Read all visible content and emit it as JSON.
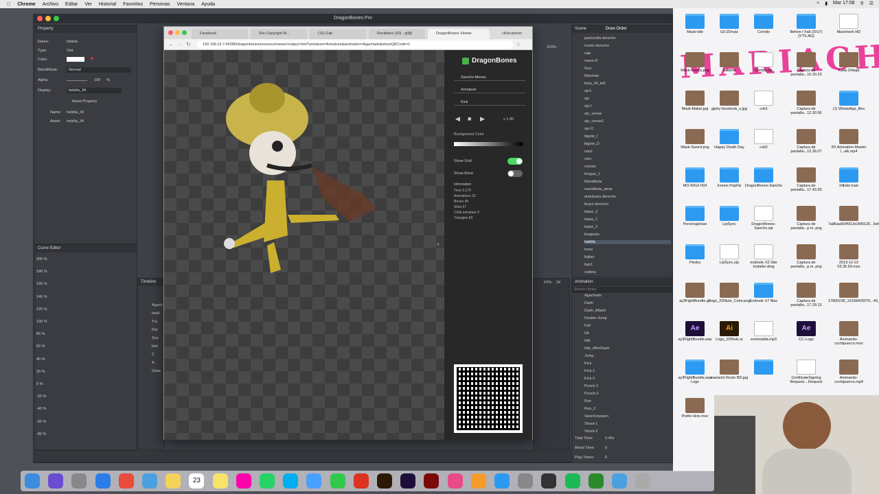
{
  "menubar": {
    "items": [
      "Chrome",
      "Archivo",
      "Editar",
      "Ver",
      "Historial",
      "Favoritos",
      "Personas",
      "Ventana",
      "Ayuda"
    ],
    "clock": "Mar 17:08"
  },
  "app": {
    "title": "DragonBones Pro",
    "property_panel": {
      "tab": "Property",
      "rows": [
        {
          "label": "Name:",
          "value": "hebilla"
        },
        {
          "label": "Type:",
          "value": "Slot"
        },
        {
          "label": "Color:",
          "value": ""
        },
        {
          "label": "BlendMode:",
          "value": "Normal"
        },
        {
          "label": "Alpha:",
          "value": "100"
        },
        {
          "label": "Display:",
          "value": "hebilla_34"
        }
      ],
      "asset_header": "Asset Property",
      "asset_rows": [
        {
          "label": "Name:",
          "value": "hebilla_34"
        },
        {
          "label": "Asset:",
          "value": "hebilla_34"
        }
      ],
      "alpha_unit": "%"
    },
    "curve_editor": {
      "tab": "Curve Editor",
      "ticks": [
        "200 %",
        "180 %",
        "160 %",
        "140 %",
        "120 %",
        "100 %",
        "80 %",
        "60 %",
        "40 %",
        "20 %",
        "0 %",
        "-20 %",
        "-40 %",
        "-60 %",
        "-80 %"
      ]
    },
    "timeline_tab": "Timeline",
    "timeline_items": [
      "Agach",
      "hebil",
      "Tra",
      "Rot",
      "Sca",
      "heb",
      "C",
      "A",
      "Draw"
    ],
    "fps": {
      "label": "FPS:",
      "value": "24"
    },
    "scene_tab": "Scene",
    "draw_order_tab": "Draw Order",
    "zoom": "215%",
    "draw_order_items": [
      "pantorrilla derecho",
      "muslo derecho",
      "raja",
      "mano-D",
      "Gun",
      "Machete",
      "bota_34_left",
      "ojo1",
      "ojo",
      "ojo-I",
      "ojo_venas",
      "ojo_venas1",
      "ojo-D",
      "bigote_I",
      "bigote_D",
      "nariz",
      "cien",
      "craneo",
      "lengua_1",
      "Mandibula",
      "mandibula_atras",
      "antebrazo derecho",
      "brazo derecho",
      "balas_3",
      "balas_1",
      "balas_2",
      "bragueta",
      "hebilla",
      "torso",
      "fajitas",
      "fajo1",
      "cadera"
    ],
    "animation_tab": "Animation",
    "search_placeholder": "Search Library",
    "animation_items": [
      "Agachado",
      "Dash",
      "Dash_Attack",
      "Double-Jump",
      "Fall",
      "Hit",
      "Idle",
      "Idle_AfterDash",
      "Jump",
      "Kick",
      "Kick-1",
      "Kick-2",
      "Punch-1",
      "Punch-2",
      "Run",
      "Run_2",
      "Sanchoryuken",
      "Shoot-1",
      "Shoot-2"
    ],
    "total_time": {
      "label": "Total Time:",
      "value": "0.46s"
    },
    "blend_time": {
      "label": "Blend Time:",
      "value": "0"
    },
    "play_times": {
      "label": "Play Times:",
      "value": "0"
    }
  },
  "browser": {
    "tabs": [
      "Facebook",
      "(No Copyright M...",
      "(16) Giip",
      "Recibidos (30) - gil@",
      "DragonBones Viewer",
      "clickcartoon"
    ],
    "url": "192.168.15.7:49286/dragonbones/resource/viewer/output.html?armature=Armature&animation=Agachado&showQRCode=1",
    "side": {
      "brand": "DragonBones",
      "dragonbones": "Sancho-Moves",
      "armature": "Armature",
      "animation": "Kick",
      "speed": "x 1.00",
      "bg_color_label": "Background Color",
      "show_grid": "Show Grid",
      "show_bone": "Show Bone",
      "info_title": "Information",
      "info": [
        "Time 0.179",
        "Animations 32",
        "Bones 45",
        "Slots 57",
        "Child armature 0",
        "Triangles 83"
      ]
    }
  },
  "desktop": {
    "scribble": "MARIACHI",
    "icons": [
      {
        "label": "Mask-Idle",
        "type": "folder"
      },
      {
        "label": "Gil-2Dnutz",
        "type": "folder"
      },
      {
        "label": "Corrido",
        "type": "folder"
      },
      {
        "label": "Before I Fall (2017) [YTS.AG]",
        "type": "folder"
      },
      {
        "label": "Macintosh HD",
        "type": "file"
      },
      {
        "label": "Mask-invoca.png",
        "type": "img"
      },
      {
        "label": "Gilberto",
        "type": "img"
      },
      {
        "label": "Corrido.zip",
        "type": "file"
      },
      {
        "label": "Captura de pantalla...10.20.23",
        "type": "img"
      },
      {
        "label": "Katia Ortega",
        "type": "img"
      },
      {
        "label": "Mask-Maker.jpg",
        "type": "img"
      },
      {
        "label": "giphy-facebook_s.jpg",
        "type": "img"
      },
      {
        "label": "coti1",
        "type": "file"
      },
      {
        "label": "Captura de pantalla...12.30.56",
        "type": "img"
      },
      {
        "label": "(1) WhatsApp_files",
        "type": "folder"
      },
      {
        "label": "Mask-Sword.png",
        "type": "img"
      },
      {
        "label": "Happy Death Day",
        "type": "folder"
      },
      {
        "label": "coti2",
        "type": "file"
      },
      {
        "label": "Captura de pantalla...12.36.07",
        "type": "img"
      },
      {
        "label": "2D Animation-Master l...alk.mp4",
        "type": "img"
      },
      {
        "label": "MO-RIG2-004",
        "type": "folder"
      },
      {
        "label": "Iconos PopFly",
        "type": "folder"
      },
      {
        "label": "DragonBones-Sancho",
        "type": "folder"
      },
      {
        "label": "Captura de pantalla...17.43.59",
        "type": "img"
      },
      {
        "label": "2dkidz-Ivan",
        "type": "folder"
      },
      {
        "label": "Personajelvan",
        "type": "folder"
      },
      {
        "label": "LipSync",
        "type": "folder"
      },
      {
        "label": "DragonBones-Sancho.zip",
        "type": "file"
      },
      {
        "label": "Captura de pantalla...p.m..png",
        "type": "img"
      },
      {
        "label": "7a86aa604f313e2bf0126...6efe.jpg",
        "type": "img"
      },
      {
        "label": "Piedra",
        "type": "folder"
      },
      {
        "label": "LipSync.zip",
        "type": "file"
      },
      {
        "label": "endnote X2 Site Installer.dmg",
        "type": "file"
      },
      {
        "label": "Captura de pantalla...p.m..png",
        "type": "img"
      },
      {
        "label": "2013-12-22 03.35.59.mov",
        "type": "img"
      },
      {
        "label": "ay3FightBundle.gif",
        "type": "img"
      },
      {
        "label": "Logo_2DNutz_Color.png",
        "type": "img"
      },
      {
        "label": "Endnote X7 Mac",
        "type": "folder"
      },
      {
        "label": "Captura de pantalla...17.29.13",
        "type": "img"
      },
      {
        "label": "17800238_10158426076...49_n.jpg",
        "type": "img"
      },
      {
        "label": "ay3FightBundle.aep",
        "type": "ae"
      },
      {
        "label": "Logo_2DNutz.ai",
        "type": "ai"
      },
      {
        "label": "esmeralda.mp3",
        "type": "file"
      },
      {
        "label": "CC-Logo",
        "type": "ae"
      },
      {
        "label": "Animando-cochipuerco.mov",
        "type": "img"
      },
      {
        "label": "ay3FightBundle.aep Logs",
        "type": "folder"
      },
      {
        "label": "mariachi Ronin BD.jpg",
        "type": "img"
      },
      {
        "label": "",
        "type": "folder"
      },
      {
        "label": "CertificateSigning Request....Request",
        "type": "file"
      },
      {
        "label": "Animando-cochipuerco.mp4",
        "type": "img"
      },
      {
        "label": "Prefer-Hire.mov",
        "type": "img"
      }
    ]
  },
  "dock": {
    "calendar_day": "23",
    "apps": [
      "finder-icon",
      "siri-icon",
      "launchpad-icon",
      "safari-icon",
      "chrome-icon",
      "preview-icon",
      "notes-icon",
      "calendar-icon",
      "stickies-icon",
      "photos-icon",
      "whatsapp-icon",
      "skype-icon",
      "messages-icon",
      "facetime-icon",
      "acrobat-icon",
      "illustrator-icon",
      "aftereffects-icon",
      "flash-icon",
      "itunes-icon",
      "ibooks-icon",
      "appstore-icon",
      "preferences-icon",
      "finalcut-icon",
      "spotify-icon",
      "dragonbones-icon",
      "drive-icon",
      "trash-icon"
    ]
  },
  "colors": {
    "accent": "#2b9af0",
    "toggle_on": "#4cd964",
    "scribble": "#e8248a"
  }
}
